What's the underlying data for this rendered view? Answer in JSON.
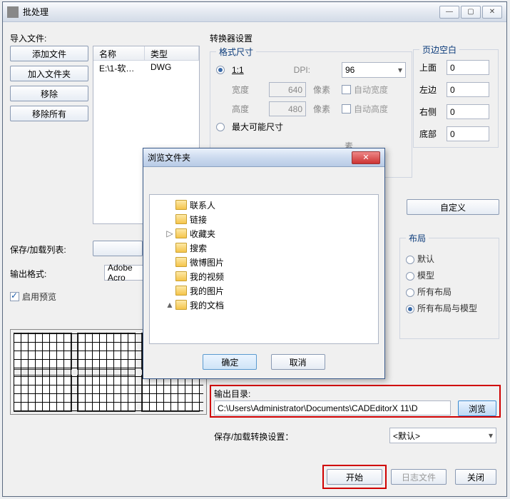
{
  "window": {
    "title": "批处理"
  },
  "import": {
    "label": "导入文件:",
    "add_file": "添加文件",
    "add_folder": "加入文件夹",
    "remove": "移除",
    "remove_all": "移除所有",
    "list_header_name": "名称",
    "list_header_type": "类型",
    "row_name": "E:\\1-软文...",
    "row_type": "DWG"
  },
  "saveload_label": "保存/加载列表:",
  "output_format_label": "输出格式:",
  "output_format_value": "Adobe Acro",
  "enable_preview": "启用预览",
  "converter": {
    "settings": "转换器设置",
    "format_size": "格式尺寸",
    "ratio_11": "1:1",
    "dpi": "DPI:",
    "dpi_value": "96",
    "width": "宽度",
    "width_value": "640",
    "px1": "像素",
    "auto_w": "自动宽度",
    "height": "高度",
    "height_value": "480",
    "px2": "像素",
    "auto_h": "自动高度",
    "max_size": "最大可能尺寸",
    "px3": "素",
    "px4": "素"
  },
  "margins": {
    "title": "页边空白",
    "top": "上面",
    "left": "左边",
    "right": "右侧",
    "bottom": "底部",
    "v": "0"
  },
  "customize": "自定义",
  "layout": {
    "title": "布局",
    "default": "默认",
    "model": "模型",
    "all_layout": "所有布局",
    "all_with_model": "所有布局与模型"
  },
  "output_dir_label": "输出目录:",
  "output_dir_value": "C:\\Users\\Administrator\\Documents\\CADEditorX 11\\D",
  "browse": "浏览",
  "save_conv_label": "保存/加载转换设置：",
  "save_conv_value": "<默认>",
  "start": "开始",
  "log": "日志文件",
  "close": "关闭",
  "dialog": {
    "title": "浏览文件夹",
    "items": [
      "联系人",
      "链接",
      "收藏夹",
      "搜索",
      "微博图片",
      "我的视频",
      "我的图片",
      "我的文档"
    ],
    "ok": "确定",
    "cancel": "取消"
  }
}
